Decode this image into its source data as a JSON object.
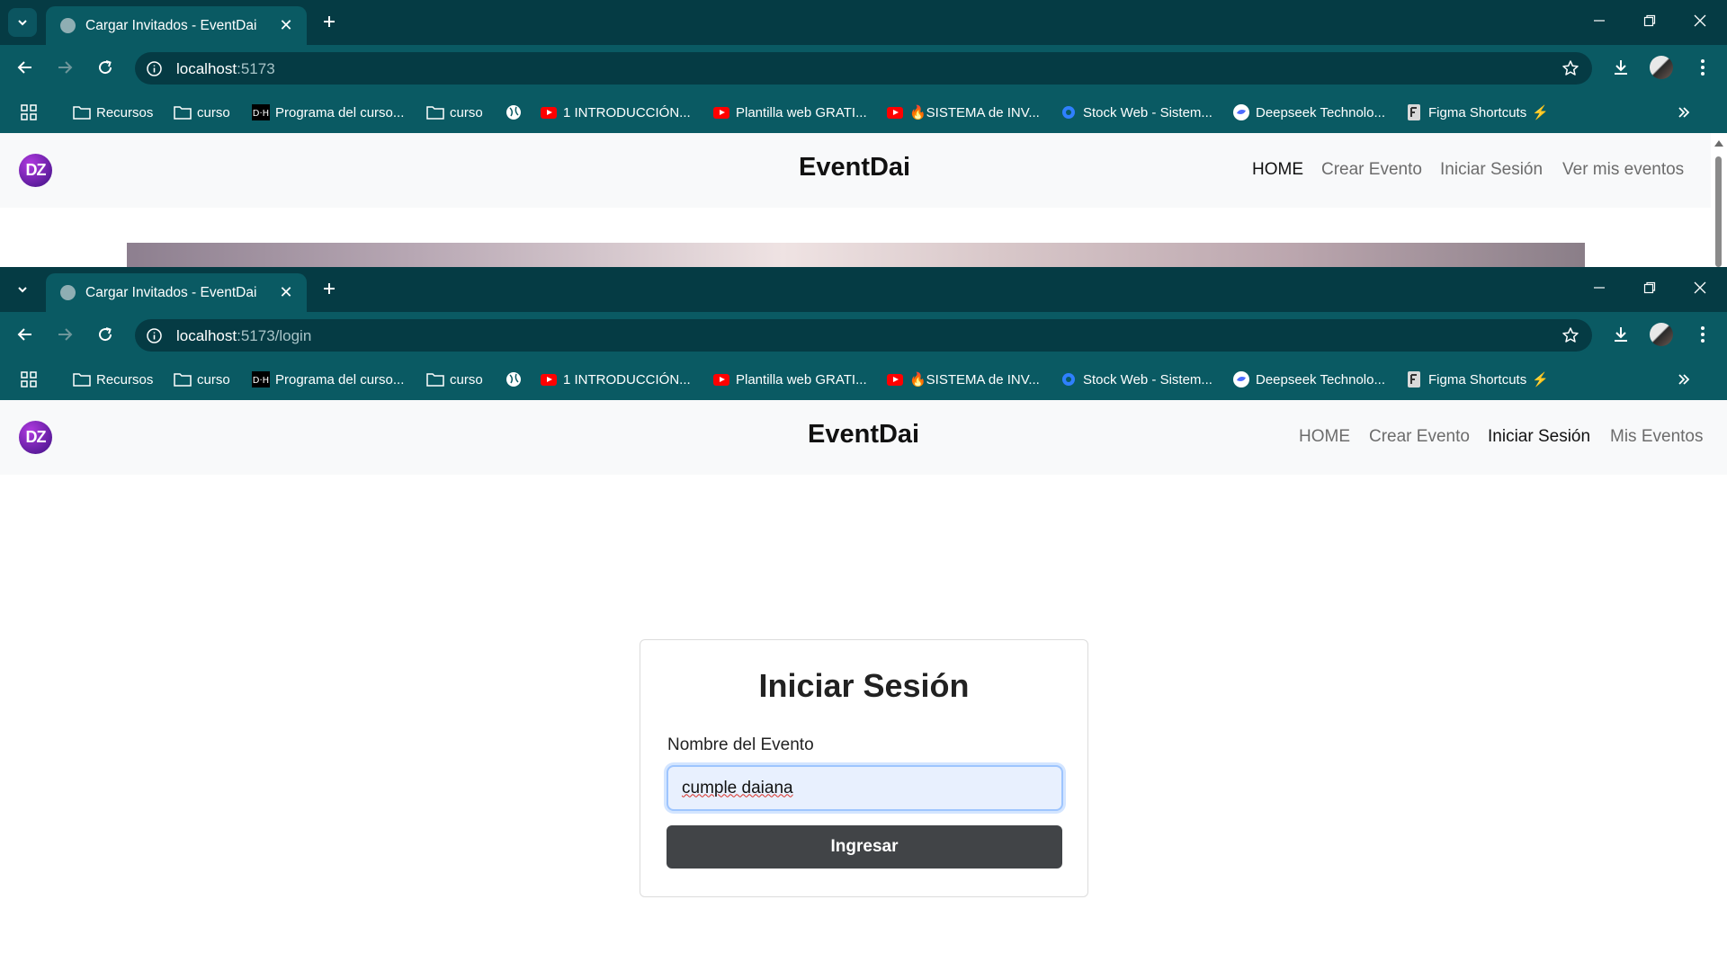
{
  "window1": {
    "tab_title": "Cargar Invitados - EventDai",
    "url_host": "localhost",
    "url_rest": ":5173",
    "app": {
      "logo_text": "DZ",
      "brand": "EventDai",
      "nav": [
        "HOME",
        "Crear Evento",
        "Iniciar Sesión",
        "Ver mis eventos"
      ],
      "active_nav": "HOME"
    }
  },
  "window2": {
    "tab_title": "Cargar Invitados - EventDai",
    "url_host": "localhost",
    "url_rest": ":5173/login",
    "app": {
      "logo_text": "DZ",
      "brand": "EventDai",
      "nav": [
        "HOME",
        "Crear Evento",
        "Iniciar Sesión",
        "Mis Eventos"
      ],
      "active_nav": "Iniciar Sesión"
    },
    "login": {
      "title": "Iniciar Sesión",
      "field_label": "Nombre del Evento",
      "field_value": "cumple daiana",
      "submit_label": "Ingresar"
    }
  },
  "bookmarks": [
    {
      "label": "",
      "icon": "apps-grid-icon"
    },
    {
      "label": "Recursos",
      "icon": "folder-icon"
    },
    {
      "label": "curso",
      "icon": "folder-icon"
    },
    {
      "label": "Programa del curso...",
      "icon": "dh-logo-icon"
    },
    {
      "label": "curso",
      "icon": "folder-icon"
    },
    {
      "label": "",
      "icon": "globe-icon"
    },
    {
      "label": "1 INTRODUCCIÓN...",
      "icon": "youtube-icon"
    },
    {
      "label": "Plantilla web GRATI...",
      "icon": "youtube-icon"
    },
    {
      "label": "🔥SISTEMA de INV...",
      "icon": "youtube-icon"
    },
    {
      "label": "Stock Web - Sistem...",
      "icon": "gear-blue-icon"
    },
    {
      "label": "Deepseek Technolo...",
      "icon": "deepseek-icon"
    },
    {
      "label": "Figma Shortcuts",
      "icon": "figma-icon"
    }
  ],
  "colors": {
    "tabbar": "#053b44",
    "toolbar": "#0a5a63",
    "navbar_bg": "#f8f9fa",
    "button": "#414447",
    "input_focus": "#e8f0fe"
  }
}
